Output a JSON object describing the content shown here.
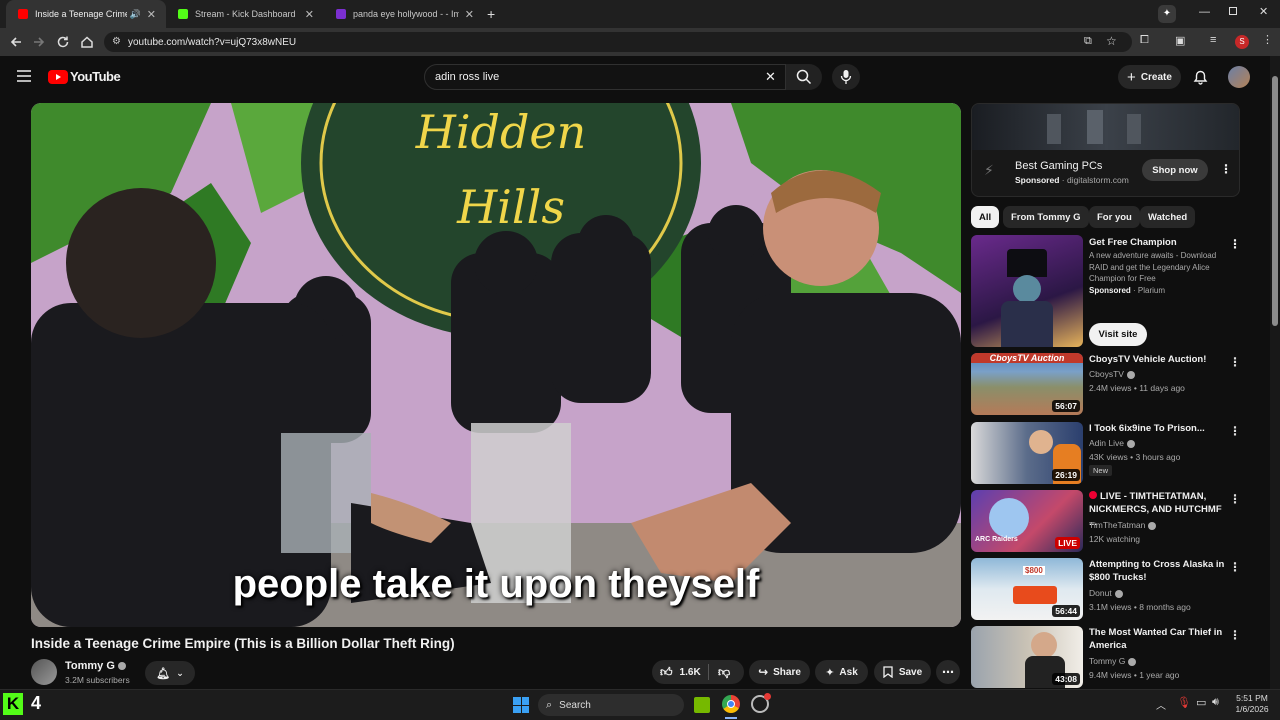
{
  "browser": {
    "tabs": [
      {
        "title": "Inside a Teenage Crime Em",
        "active": true
      },
      {
        "title": "Stream - Kick Dashboard",
        "active": false
      },
      {
        "title": "panda eye hollywood - - Image",
        "active": false
      }
    ],
    "url": "youtube.com/watch?v=ujQ73x8wNEU",
    "profile_initial": "S"
  },
  "youtube": {
    "logo_text": "YouTube",
    "search_value": "adin ross live",
    "create_label": "Create"
  },
  "video": {
    "caption": "people take it upon theyself",
    "sign_text_top": "Hidden",
    "sign_text_bottom": "Hills",
    "title": "Inside a Teenage Crime Empire (This is a Billion Dollar Theft Ring)",
    "channel": "Tommy G",
    "subscribers": "3.2M subscribers",
    "likes": "1.6K",
    "share_label": "Share",
    "ask_label": "Ask",
    "save_label": "Save"
  },
  "ad": {
    "title": "Best Gaming PCs",
    "sponsored": "Sponsored",
    "domain": "digitalstorm.com",
    "cta": "Shop now"
  },
  "chips": [
    "All",
    "From Tommy G",
    "For you",
    "Watched"
  ],
  "promo": {
    "title": "Get Free Champion",
    "desc": "A new adventure awaits - Download RAID and get the Legendary Alice Champion for Free",
    "sponsored": "Sponsored",
    "advertiser": "Plarium",
    "cta": "Visit site"
  },
  "recommendations": [
    {
      "title": "CboysTV Vehicle Auction!",
      "channel": "CboysTV",
      "meta": "2.4M views • 11 days ago",
      "duration": "56:07",
      "thumb_text": "CboysTV Auction"
    },
    {
      "title": "I Took 6ix9ine To Prison...",
      "channel": "Adin Live",
      "meta": "43K views • 3 hours ago",
      "duration": "26:19",
      "badge": "New"
    },
    {
      "title": "LIVE - TIMTHETATMAN, NICKMERCS, AND HUTCHMF ...",
      "channel": "TimTheTatman",
      "meta": "12K watching",
      "duration": "LIVE",
      "thumb_text": "ARC Raiders"
    },
    {
      "title": "Attempting to Cross Alaska in $800 Trucks!",
      "channel": "Donut",
      "meta": "3.1M views • 8 months ago",
      "duration": "56:44",
      "thumb_text": "$800"
    },
    {
      "title": "The Most Wanted Car Thief in America",
      "channel": "Tommy G",
      "meta": "9.4M views • 1 year ago",
      "duration": "43:08"
    }
  ],
  "taskbar": {
    "kick_count": "4",
    "search_label": "Search",
    "time": "5:51 PM",
    "date": "1/6/2026"
  }
}
